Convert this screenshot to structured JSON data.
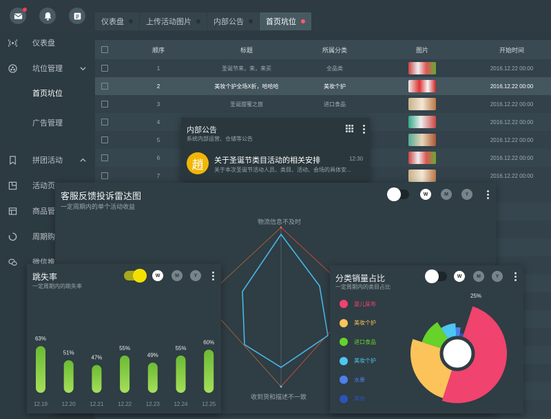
{
  "tabs": [
    {
      "label": "仪表盘",
      "active": false
    },
    {
      "label": "上传活动图片",
      "active": false
    },
    {
      "label": "内部公告",
      "active": false
    },
    {
      "label": "首页坑位",
      "active": true
    }
  ],
  "sidebar": {
    "items": [
      {
        "label": "仪表盘",
        "icon": "signal-icon"
      },
      {
        "label": "坑位管理",
        "icon": "layers-icon",
        "expanded": true
      },
      {
        "label": "首页坑位",
        "icon": "",
        "selected": true
      },
      {
        "label": "广告管理",
        "icon": ""
      },
      {
        "label": "拼团活动",
        "icon": "bookmark-icon",
        "expanded": true
      },
      {
        "label": "活动页",
        "icon": "page-icon"
      },
      {
        "label": "商品管",
        "icon": "store-icon"
      },
      {
        "label": "周期购",
        "icon": "cycle-icon"
      },
      {
        "label": "微信推",
        "icon": "wechat-icon"
      }
    ]
  },
  "table": {
    "headers": [
      "顺序",
      "标题",
      "所属分类",
      "图片",
      "开始时间"
    ],
    "rows": [
      {
        "order": "1",
        "title": "圣诞节来，来，来买",
        "category": "全品类",
        "time": "2016.12.22 00:00"
      },
      {
        "order": "2",
        "title": "美妆个护全场X折，哈哈哈",
        "category": "美妆个护",
        "time": "2016.12.22 00:00"
      },
      {
        "order": "3",
        "title": "圣诞甜蜜之旅",
        "category": "进口食品",
        "time": "2016.12.22 00:00"
      },
      {
        "order": "4",
        "title": "",
        "category": "",
        "time": "2016.12.22 00:00"
      },
      {
        "order": "5",
        "title": "",
        "category": "",
        "time": "2016.12.22 00:00"
      },
      {
        "order": "6",
        "title": "",
        "category": "",
        "time": "2016.12.22 00:00"
      },
      {
        "order": "7",
        "title": "",
        "category": "",
        "time": "2016.12.22 00:00"
      }
    ]
  },
  "notice": {
    "title": "内部公告",
    "subtitle": "系统内部运营、仓储等公告",
    "avatar_char": "趙",
    "item_title": "关于圣诞节类目活动的相关安排",
    "item_time": "12:30",
    "item_desc": "关于本次圣诞节活动人员、类目、活动、会场的具体安..."
  },
  "radar": {
    "title": "客服反馈投诉雷达图",
    "subtitle": "一定周期内的单个活动收益",
    "label_top": "物流信息不及时",
    "label_bottom": "收到货和描述不一致",
    "pills": [
      "W",
      "M",
      "Y"
    ]
  },
  "bounce": {
    "title": "跳失率",
    "subtitle": "一定周期内的跳失率",
    "pills": [
      "W",
      "M",
      "Y"
    ]
  },
  "share": {
    "title": "分类销量占比",
    "subtitle": "一定周期内的类目占比",
    "pills": [
      "W",
      "M",
      "Y"
    ]
  },
  "chart_data": [
    {
      "type": "bar",
      "categories": [
        "12.19",
        "12.20",
        "12.21",
        "12.22",
        "12.23",
        "12.24",
        "12.25"
      ],
      "values": [
        63,
        51,
        47,
        55,
        49,
        55,
        60
      ],
      "value_labels": [
        "63%",
        "51%",
        "47%",
        "55%",
        "49%",
        "55%",
        "60%"
      ],
      "ylim": [
        0,
        100
      ],
      "color": "#7cc63a"
    },
    {
      "type": "pie",
      "legend": [
        "婴儿尿布",
        "美妆个护",
        "进口食品",
        "美妆个护",
        "水果",
        "其他"
      ],
      "colors": [
        "#f0436e",
        "#fcc35a",
        "#66d22a",
        "#4cc7f2",
        "#4f7fef",
        "#2b54b8"
      ],
      "values": [
        50,
        25,
        11,
        8,
        3,
        3
      ],
      "annotation": "25%"
    }
  ]
}
